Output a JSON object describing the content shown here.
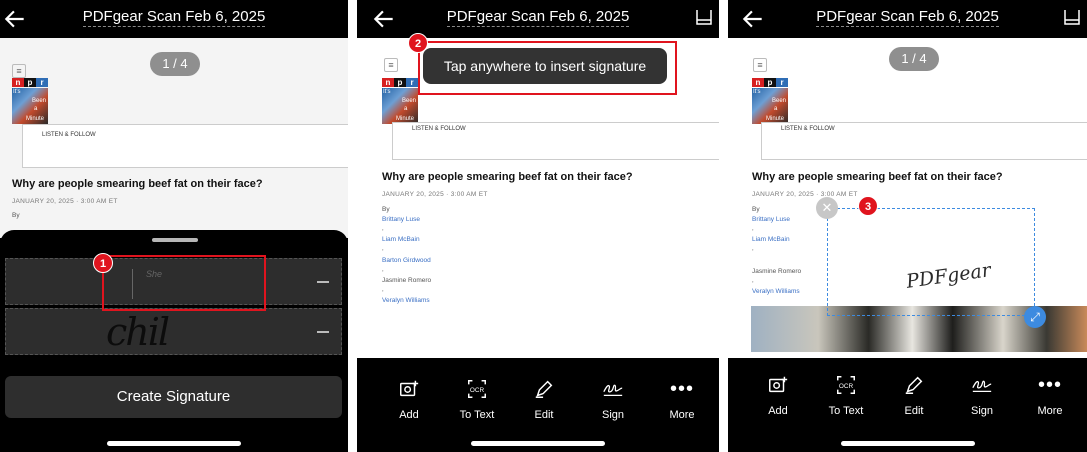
{
  "common": {
    "title": "PDFgear Scan Feb 6, 2025",
    "page_indicator": "1 / 4",
    "article": {
      "npr_letters": [
        "n",
        "p",
        "r"
      ],
      "logo_text": [
        "It's",
        "Been",
        "a",
        "Minute"
      ],
      "listen": "LISTEN & FOLLOW",
      "headline": "Why are people smearing beef fat on their face?",
      "date": "JANUARY 20, 2025 · 3:00 AM ET",
      "by": "By",
      "authors": [
        "Brittany Luse",
        "Liam McBain",
        "Barton Girdwood",
        "Jasmine Romero",
        "Veralyn Williams"
      ]
    },
    "toolbar": {
      "add": "Add",
      "to_text": "To Text",
      "edit": "Edit",
      "sign": "Sign",
      "more": "More",
      "ocr_glyph": "OCR"
    }
  },
  "panel1": {
    "badge": "1",
    "create_signature": "Create Signature",
    "sig1_text": "She",
    "sig2_text": "chil"
  },
  "panel2": {
    "badge": "2",
    "toast": "Tap anywhere to insert signature"
  },
  "panel3": {
    "badge": "3",
    "signature_text": "PDFgear"
  },
  "colors": {
    "accent_red": "#e0141e",
    "selection_blue": "#3d8be0",
    "author_link": "#3a6fc4"
  }
}
